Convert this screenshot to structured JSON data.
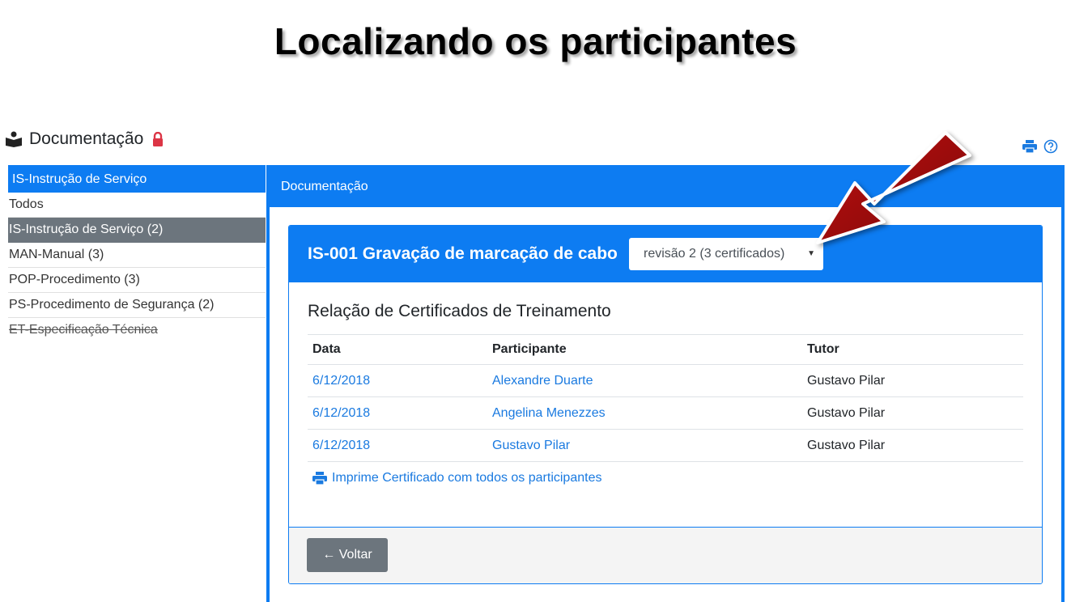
{
  "slide": {
    "title": "Localizando os participantes"
  },
  "header": {
    "title": "Documentação"
  },
  "sidebar": {
    "active_category": "IS-Instrução de Serviço",
    "items": [
      {
        "label": "Todos",
        "state": "normal"
      },
      {
        "label": "IS-Instrução de Serviço (2)",
        "state": "selected"
      },
      {
        "label": "MAN-Manual (3)",
        "state": "normal"
      },
      {
        "label": "POP-Procedimento (3)",
        "state": "normal"
      },
      {
        "label": "PS-Procedimento de Segurança (2)",
        "state": "normal"
      },
      {
        "label": "ET-Especificação Técnica",
        "state": "struck"
      }
    ]
  },
  "panel": {
    "title": "Documentação"
  },
  "document": {
    "title": "IS-001 Gravação de marcação de cabo",
    "revision_select": "revisão 2 (3 certificados)"
  },
  "certificates": {
    "section_title": "Relação de Certificados de Treinamento",
    "columns": [
      "Data",
      "Participante",
      "Tutor"
    ],
    "rows": [
      {
        "date": "6/12/2018",
        "participant": "Alexandre Duarte",
        "tutor": "Gustavo Pilar"
      },
      {
        "date": "6/12/2018",
        "participant": "Angelina Menezzes",
        "tutor": "Gustavo Pilar"
      },
      {
        "date": "6/12/2018",
        "participant": "Gustavo Pilar",
        "tutor": "Gustavo Pilar"
      }
    ],
    "print_link": "Imprime Certificado com todos os participantes"
  },
  "footer": {
    "back_label": "← Voltar"
  },
  "colors": {
    "primary": "#0d7cf2",
    "link": "#1a7ae0",
    "secondary": "#6c757d",
    "lock": "#dc3545",
    "arrow": "#a30d0d"
  },
  "icons": {
    "header": "book-reader-icon",
    "lock": "lock-icon",
    "print": "print-icon",
    "help": "help-circle-icon"
  }
}
